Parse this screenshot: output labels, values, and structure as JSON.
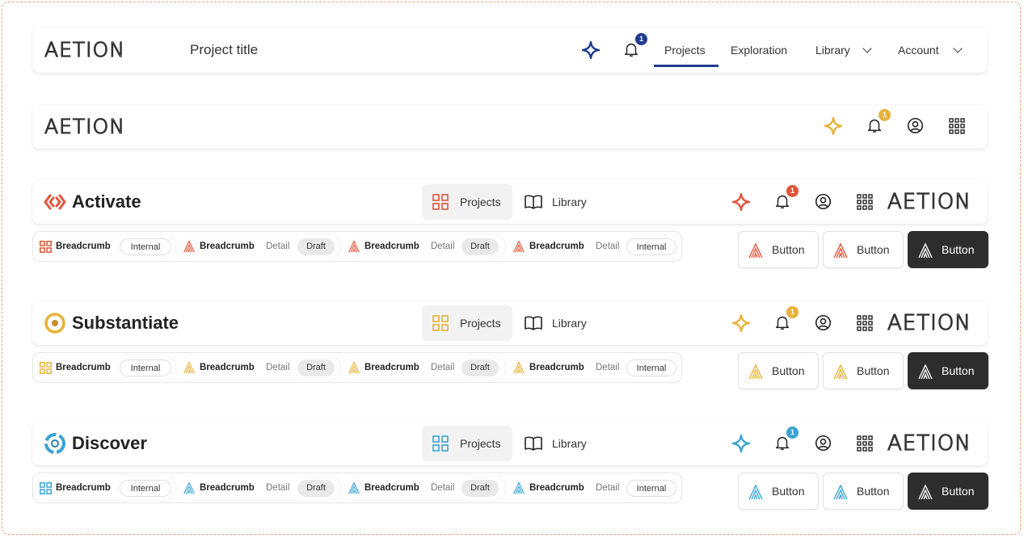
{
  "brand": {
    "wordmark": "AETION"
  },
  "header1": {
    "project_title": "Project title",
    "accent": "#1f3a8f",
    "notification_count": "1",
    "nav": {
      "projects": "Projects",
      "exploration": "Exploration",
      "library": "Library",
      "account": "Account"
    },
    "active_tab": "Projects"
  },
  "header2": {
    "accent": "#e8b23a",
    "notification_count": "1"
  },
  "variants": [
    {
      "product": "Activate",
      "accent": "#e0553a",
      "notification_count": "1",
      "tabs": {
        "projects": "Projects",
        "library": "Library"
      },
      "breadcrumbs": [
        {
          "name": "Breadcrumb",
          "detail": "",
          "status": "Internal"
        },
        {
          "name": "Breadcrumb",
          "detail": "Detail",
          "status": "Draft"
        },
        {
          "name": "Breadcrumb",
          "detail": "Detail",
          "status": "Draft"
        },
        {
          "name": "Breadcrumb",
          "detail": "Detail",
          "status": "Internal"
        }
      ],
      "buttons": [
        "Button",
        "Button",
        "Button"
      ]
    },
    {
      "product": "Substantiate",
      "accent": "#e8b23a",
      "notification_count": "1",
      "tabs": {
        "projects": "Projects",
        "library": "Library"
      },
      "breadcrumbs": [
        {
          "name": "Breadcrumb",
          "detail": "",
          "status": "Internal"
        },
        {
          "name": "Breadcrumb",
          "detail": "Detail",
          "status": "Draft"
        },
        {
          "name": "Breadcrumb",
          "detail": "Detail",
          "status": "Draft"
        },
        {
          "name": "Breadcrumb",
          "detail": "Detail",
          "status": "Internal"
        }
      ],
      "buttons": [
        "Button",
        "Button",
        "Button"
      ]
    },
    {
      "product": "Discover",
      "accent": "#3aa3d4",
      "notification_count": "1",
      "tabs": {
        "projects": "Projects",
        "library": "Library"
      },
      "breadcrumbs": [
        {
          "name": "Breadcrumb",
          "detail": "",
          "status": "Internal"
        },
        {
          "name": "Breadcrumb",
          "detail": "Detail",
          "status": "Draft"
        },
        {
          "name": "Breadcrumb",
          "detail": "Detail",
          "status": "Draft"
        },
        {
          "name": "Breadcrumb",
          "detail": "Detail",
          "status": "Internal"
        }
      ],
      "buttons": [
        "Button",
        "Button",
        "Button"
      ]
    }
  ],
  "icons": [
    "sparkle-icon",
    "bell-icon",
    "user-circle-icon",
    "apps-grid-icon",
    "grid-icon",
    "book-icon",
    "aetion-a-icon",
    "chevron-down-icon"
  ]
}
